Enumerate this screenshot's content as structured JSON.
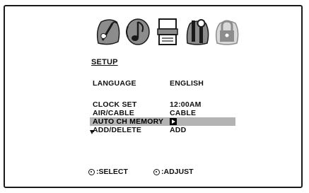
{
  "menu": {
    "icons": [
      "picture-tools-icon",
      "audio-note-icon",
      "channel-tuner-icon",
      "setup-tools-icon",
      "lock-icon"
    ],
    "title": "SETUP",
    "items": [
      {
        "label": "LANGUAGE",
        "value": "ENGLISH"
      },
      {
        "label": "CLOCK SET",
        "value": "12:00AM"
      },
      {
        "label": "AIR/CABLE",
        "value": "CABLE"
      },
      {
        "label": "AUTO CH MEMORY",
        "value": "",
        "selected": true,
        "value_icon": "play-arrow-icon"
      },
      {
        "label": "ADD/DELETE",
        "value": "ADD"
      }
    ],
    "more_indicator": "down-arrow-icon"
  },
  "footer": {
    "select_label": ":SELECT",
    "adjust_label": ":ADJUST"
  },
  "colors": {
    "highlight": "#b3b3b3",
    "icon_fill": "#8c8c8c",
    "icon_stroke": "#1a1a1a",
    "text": "#111111"
  }
}
